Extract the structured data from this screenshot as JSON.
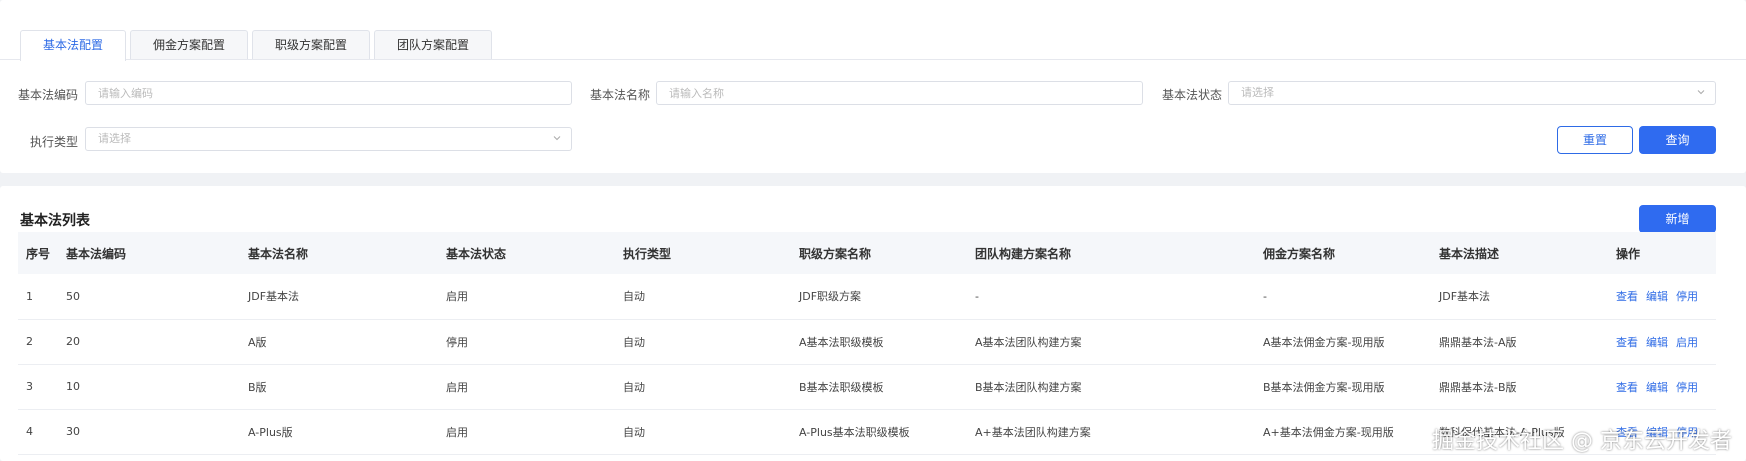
{
  "tabs": [
    {
      "label": "基本法配置",
      "active": true
    },
    {
      "label": "佣金方案配置",
      "active": false
    },
    {
      "label": "职级方案配置",
      "active": false
    },
    {
      "label": "团队方案配置",
      "active": false
    }
  ],
  "filters": {
    "code": {
      "label": "基本法编码",
      "placeholder": "请输入编码"
    },
    "name": {
      "label": "基本法名称",
      "placeholder": "请输入名称"
    },
    "status": {
      "label": "基本法状态",
      "placeholder": "请选择"
    },
    "exec_type": {
      "label": "执行类型",
      "placeholder": "请选择"
    },
    "reset_label": "重置",
    "query_label": "查询"
  },
  "list": {
    "title": "基本法列表",
    "add_label": "新增",
    "columns": [
      "序号",
      "基本法编码",
      "基本法名称",
      "基本法状态",
      "执行类型",
      "职级方案名称",
      "团队构建方案名称",
      "佣金方案名称",
      "基本法描述",
      "操作"
    ],
    "rows": [
      {
        "cells": [
          "1",
          "50",
          "JDF基本法",
          "启用",
          "自动",
          "JDF职级方案",
          "-",
          "-",
          "JDF基本法"
        ],
        "ops": [
          "查看",
          "编辑",
          "停用"
        ]
      },
      {
        "cells": [
          "2",
          "20",
          "A版",
          "停用",
          "自动",
          "A基本法职级模板",
          "A基本法团队构建方案",
          "A基本法佣金方案-现用版",
          "鼎鼎基本法-A版"
        ],
        "ops": [
          "查看",
          "编辑",
          "启用"
        ]
      },
      {
        "cells": [
          "3",
          "10",
          "B版",
          "启用",
          "自动",
          "B基本法职级模板",
          "B基本法团队构建方案",
          "B基本法佣金方案-现用版",
          "鼎鼎基本法-B版"
        ],
        "ops": [
          "查看",
          "编辑",
          "停用"
        ]
      },
      {
        "cells": [
          "4",
          "30",
          "A-Plus版",
          "启用",
          "自动",
          "A-Plus基本法职级模板",
          "A+基本法团队构建方案",
          "A+基本法佣金方案-现用版",
          "数科保代基本法-A-Plus版"
        ],
        "ops": [
          "查看",
          "编辑",
          "停用"
        ]
      }
    ]
  },
  "watermark": "掘金技术社区 @ 京东云开发者",
  "colors": {
    "accent": "#2f6bf0",
    "link": "#2e6be6"
  }
}
